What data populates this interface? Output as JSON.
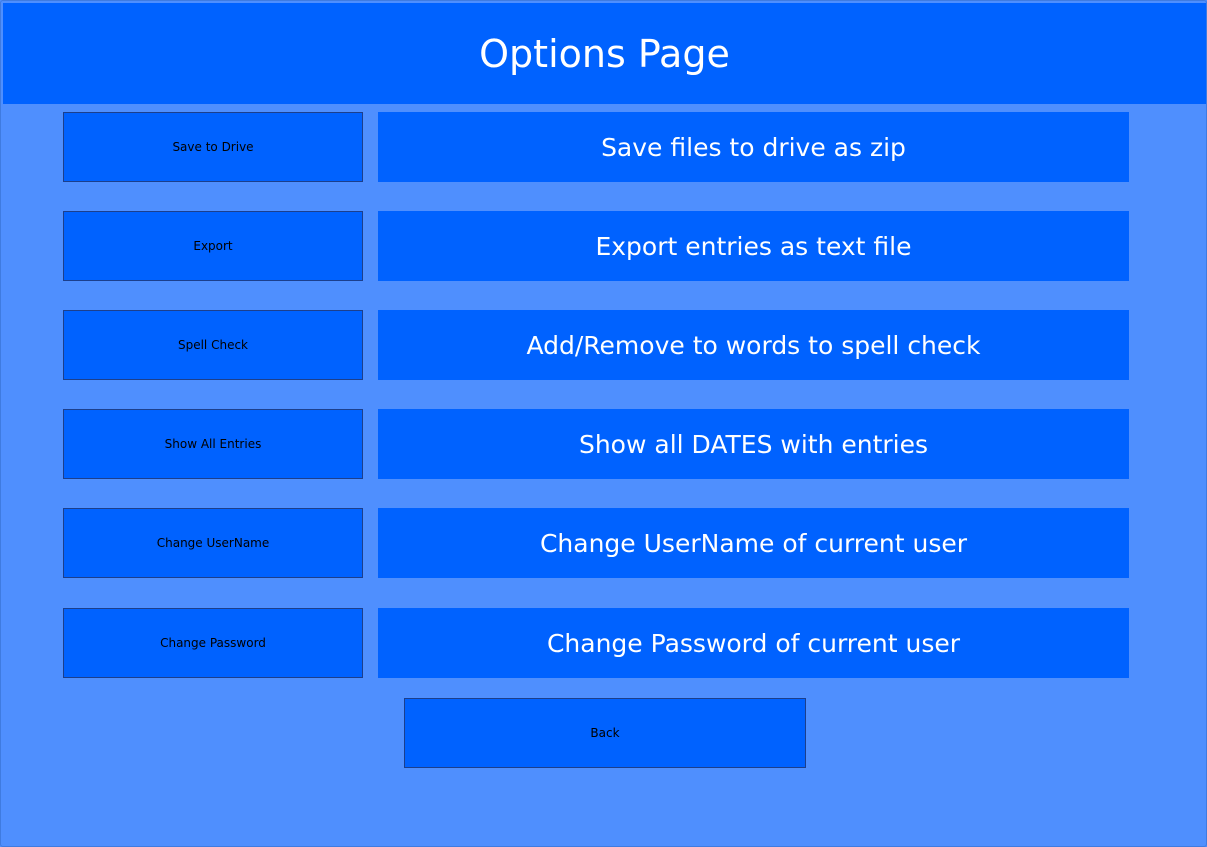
{
  "header": {
    "title": "Options Page"
  },
  "options": [
    {
      "button_label": "Save to Drive",
      "description": "Save files to drive as zip"
    },
    {
      "button_label": "Export",
      "description": "Export entries as text file"
    },
    {
      "button_label": "Spell Check",
      "description": "Add/Remove to words to spell check"
    },
    {
      "button_label": "Show All Entries",
      "description": "Show all DATES with entries"
    },
    {
      "button_label": "Change UserName",
      "description": "Change UserName of current user"
    },
    {
      "button_label": "Change Password",
      "description": "Change Password of current user"
    }
  ],
  "back_label": "Back",
  "colors": {
    "background": "#4f8ffe",
    "panel": "#0062ff",
    "button_text": "#000000",
    "description_text": "#ffffff"
  }
}
